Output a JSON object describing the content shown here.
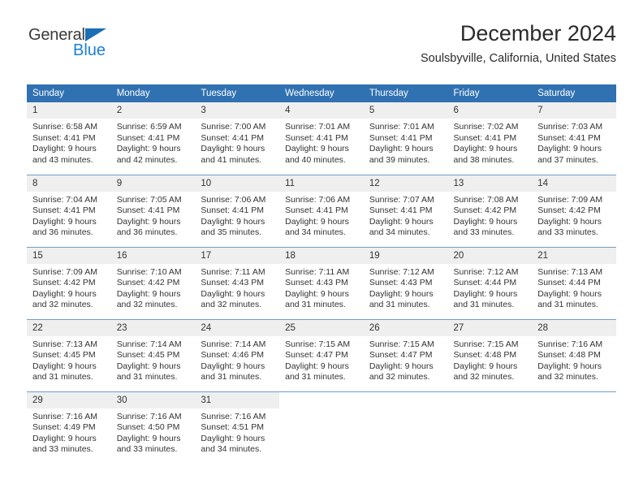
{
  "logo": {
    "word_one": "General",
    "word_two": "Blue",
    "triangle_icon": "triangle-icon",
    "brand_dark": "#3a3a3a",
    "brand_blue": "#1b7fd4",
    "triangle_blue": "#1b6fb5"
  },
  "header": {
    "title": "December 2024",
    "subtitle": "Soulsbyville, California, United States"
  },
  "theme": {
    "header_blue": "#3071b2",
    "daynum_band": "#efefef",
    "row_divider": "#6f9fc8",
    "text": "#333333"
  },
  "weekday_headers": [
    "Sunday",
    "Monday",
    "Tuesday",
    "Wednesday",
    "Thursday",
    "Friday",
    "Saturday"
  ],
  "weeks": [
    [
      {
        "day": "1",
        "sunrise": "Sunrise: 6:58 AM",
        "sunset": "Sunset: 4:41 PM",
        "daylight_1": "Daylight: 9 hours",
        "daylight_2": "and 43 minutes."
      },
      {
        "day": "2",
        "sunrise": "Sunrise: 6:59 AM",
        "sunset": "Sunset: 4:41 PM",
        "daylight_1": "Daylight: 9 hours",
        "daylight_2": "and 42 minutes."
      },
      {
        "day": "3",
        "sunrise": "Sunrise: 7:00 AM",
        "sunset": "Sunset: 4:41 PM",
        "daylight_1": "Daylight: 9 hours",
        "daylight_2": "and 41 minutes."
      },
      {
        "day": "4",
        "sunrise": "Sunrise: 7:01 AM",
        "sunset": "Sunset: 4:41 PM",
        "daylight_1": "Daylight: 9 hours",
        "daylight_2": "and 40 minutes."
      },
      {
        "day": "5",
        "sunrise": "Sunrise: 7:01 AM",
        "sunset": "Sunset: 4:41 PM",
        "daylight_1": "Daylight: 9 hours",
        "daylight_2": "and 39 minutes."
      },
      {
        "day": "6",
        "sunrise": "Sunrise: 7:02 AM",
        "sunset": "Sunset: 4:41 PM",
        "daylight_1": "Daylight: 9 hours",
        "daylight_2": "and 38 minutes."
      },
      {
        "day": "7",
        "sunrise": "Sunrise: 7:03 AM",
        "sunset": "Sunset: 4:41 PM",
        "daylight_1": "Daylight: 9 hours",
        "daylight_2": "and 37 minutes."
      }
    ],
    [
      {
        "day": "8",
        "sunrise": "Sunrise: 7:04 AM",
        "sunset": "Sunset: 4:41 PM",
        "daylight_1": "Daylight: 9 hours",
        "daylight_2": "and 36 minutes."
      },
      {
        "day": "9",
        "sunrise": "Sunrise: 7:05 AM",
        "sunset": "Sunset: 4:41 PM",
        "daylight_1": "Daylight: 9 hours",
        "daylight_2": "and 36 minutes."
      },
      {
        "day": "10",
        "sunrise": "Sunrise: 7:06 AM",
        "sunset": "Sunset: 4:41 PM",
        "daylight_1": "Daylight: 9 hours",
        "daylight_2": "and 35 minutes."
      },
      {
        "day": "11",
        "sunrise": "Sunrise: 7:06 AM",
        "sunset": "Sunset: 4:41 PM",
        "daylight_1": "Daylight: 9 hours",
        "daylight_2": "and 34 minutes."
      },
      {
        "day": "12",
        "sunrise": "Sunrise: 7:07 AM",
        "sunset": "Sunset: 4:41 PM",
        "daylight_1": "Daylight: 9 hours",
        "daylight_2": "and 34 minutes."
      },
      {
        "day": "13",
        "sunrise": "Sunrise: 7:08 AM",
        "sunset": "Sunset: 4:42 PM",
        "daylight_1": "Daylight: 9 hours",
        "daylight_2": "and 33 minutes."
      },
      {
        "day": "14",
        "sunrise": "Sunrise: 7:09 AM",
        "sunset": "Sunset: 4:42 PM",
        "daylight_1": "Daylight: 9 hours",
        "daylight_2": "and 33 minutes."
      }
    ],
    [
      {
        "day": "15",
        "sunrise": "Sunrise: 7:09 AM",
        "sunset": "Sunset: 4:42 PM",
        "daylight_1": "Daylight: 9 hours",
        "daylight_2": "and 32 minutes."
      },
      {
        "day": "16",
        "sunrise": "Sunrise: 7:10 AM",
        "sunset": "Sunset: 4:42 PM",
        "daylight_1": "Daylight: 9 hours",
        "daylight_2": "and 32 minutes."
      },
      {
        "day": "17",
        "sunrise": "Sunrise: 7:11 AM",
        "sunset": "Sunset: 4:43 PM",
        "daylight_1": "Daylight: 9 hours",
        "daylight_2": "and 32 minutes."
      },
      {
        "day": "18",
        "sunrise": "Sunrise: 7:11 AM",
        "sunset": "Sunset: 4:43 PM",
        "daylight_1": "Daylight: 9 hours",
        "daylight_2": "and 31 minutes."
      },
      {
        "day": "19",
        "sunrise": "Sunrise: 7:12 AM",
        "sunset": "Sunset: 4:43 PM",
        "daylight_1": "Daylight: 9 hours",
        "daylight_2": "and 31 minutes."
      },
      {
        "day": "20",
        "sunrise": "Sunrise: 7:12 AM",
        "sunset": "Sunset: 4:44 PM",
        "daylight_1": "Daylight: 9 hours",
        "daylight_2": "and 31 minutes."
      },
      {
        "day": "21",
        "sunrise": "Sunrise: 7:13 AM",
        "sunset": "Sunset: 4:44 PM",
        "daylight_1": "Daylight: 9 hours",
        "daylight_2": "and 31 minutes."
      }
    ],
    [
      {
        "day": "22",
        "sunrise": "Sunrise: 7:13 AM",
        "sunset": "Sunset: 4:45 PM",
        "daylight_1": "Daylight: 9 hours",
        "daylight_2": "and 31 minutes."
      },
      {
        "day": "23",
        "sunrise": "Sunrise: 7:14 AM",
        "sunset": "Sunset: 4:45 PM",
        "daylight_1": "Daylight: 9 hours",
        "daylight_2": "and 31 minutes."
      },
      {
        "day": "24",
        "sunrise": "Sunrise: 7:14 AM",
        "sunset": "Sunset: 4:46 PM",
        "daylight_1": "Daylight: 9 hours",
        "daylight_2": "and 31 minutes."
      },
      {
        "day": "25",
        "sunrise": "Sunrise: 7:15 AM",
        "sunset": "Sunset: 4:47 PM",
        "daylight_1": "Daylight: 9 hours",
        "daylight_2": "and 31 minutes."
      },
      {
        "day": "26",
        "sunrise": "Sunrise: 7:15 AM",
        "sunset": "Sunset: 4:47 PM",
        "daylight_1": "Daylight: 9 hours",
        "daylight_2": "and 32 minutes."
      },
      {
        "day": "27",
        "sunrise": "Sunrise: 7:15 AM",
        "sunset": "Sunset: 4:48 PM",
        "daylight_1": "Daylight: 9 hours",
        "daylight_2": "and 32 minutes."
      },
      {
        "day": "28",
        "sunrise": "Sunrise: 7:16 AM",
        "sunset": "Sunset: 4:48 PM",
        "daylight_1": "Daylight: 9 hours",
        "daylight_2": "and 32 minutes."
      }
    ],
    [
      {
        "day": "29",
        "sunrise": "Sunrise: 7:16 AM",
        "sunset": "Sunset: 4:49 PM",
        "daylight_1": "Daylight: 9 hours",
        "daylight_2": "and 33 minutes."
      },
      {
        "day": "30",
        "sunrise": "Sunrise: 7:16 AM",
        "sunset": "Sunset: 4:50 PM",
        "daylight_1": "Daylight: 9 hours",
        "daylight_2": "and 33 minutes."
      },
      {
        "day": "31",
        "sunrise": "Sunrise: 7:16 AM",
        "sunset": "Sunset: 4:51 PM",
        "daylight_1": "Daylight: 9 hours",
        "daylight_2": "and 34 minutes."
      },
      {
        "day": "",
        "sunrise": "",
        "sunset": "",
        "daylight_1": "",
        "daylight_2": ""
      },
      {
        "day": "",
        "sunrise": "",
        "sunset": "",
        "daylight_1": "",
        "daylight_2": ""
      },
      {
        "day": "",
        "sunrise": "",
        "sunset": "",
        "daylight_1": "",
        "daylight_2": ""
      },
      {
        "day": "",
        "sunrise": "",
        "sunset": "",
        "daylight_1": "",
        "daylight_2": ""
      }
    ]
  ]
}
